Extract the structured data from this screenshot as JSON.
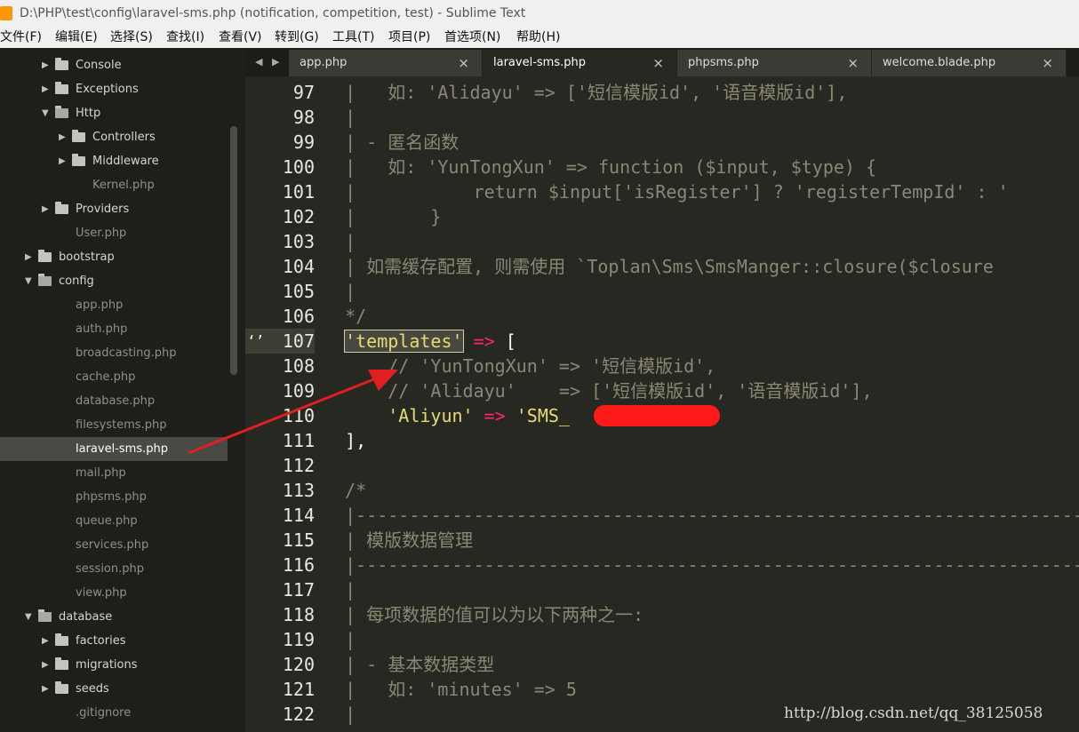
{
  "window": {
    "title": "D:\\PHP\\test\\config\\laravel-sms.php (notification, competition, test) - Sublime Text"
  },
  "menu": [
    "文件(F)",
    "编辑(E)",
    "选择(S)",
    "查找(I)",
    "查看(V)",
    "转到(G)",
    "工具(T)",
    "项目(P)",
    "首选项(N)",
    "帮助(H)"
  ],
  "sidebar": {
    "items": [
      {
        "label": "Console",
        "type": "folder"
      },
      {
        "label": "Exceptions",
        "type": "folder"
      },
      {
        "label": "Http",
        "type": "folder-open"
      },
      {
        "label": "Controllers",
        "type": "folder"
      },
      {
        "label": "Middleware",
        "type": "folder"
      },
      {
        "label": "Kernel.php",
        "type": "file"
      },
      {
        "label": "Providers",
        "type": "folder"
      },
      {
        "label": "User.php",
        "type": "file"
      },
      {
        "label": "bootstrap",
        "type": "folder"
      },
      {
        "label": "config",
        "type": "folder-open"
      },
      {
        "label": "app.php",
        "type": "file"
      },
      {
        "label": "auth.php",
        "type": "file"
      },
      {
        "label": "broadcasting.php",
        "type": "file"
      },
      {
        "label": "cache.php",
        "type": "file"
      },
      {
        "label": "database.php",
        "type": "file"
      },
      {
        "label": "filesystems.php",
        "type": "file"
      },
      {
        "label": "laravel-sms.php",
        "type": "file",
        "selected": true
      },
      {
        "label": "mail.php",
        "type": "file"
      },
      {
        "label": "phpsms.php",
        "type": "file"
      },
      {
        "label": "queue.php",
        "type": "file"
      },
      {
        "label": "services.php",
        "type": "file"
      },
      {
        "label": "session.php",
        "type": "file"
      },
      {
        "label": "view.php",
        "type": "file"
      },
      {
        "label": "database",
        "type": "folder-open"
      },
      {
        "label": "factories",
        "type": "folder"
      },
      {
        "label": "migrations",
        "type": "folder"
      },
      {
        "label": "seeds",
        "type": "folder"
      },
      {
        "label": ".gitignore",
        "type": "file"
      }
    ]
  },
  "tabs": [
    {
      "label": "app.php"
    },
    {
      "label": "laravel-sms.php",
      "active": true
    },
    {
      "label": "phpsms.php"
    },
    {
      "label": "welcome.blade.php"
    }
  ],
  "editor": {
    "current_line": 107,
    "lines": [
      {
        "num": "97",
        "segments": [
          {
            "c": "com",
            "t": "  |   如: 'Alidayu' => ['短信模版id', '语音模版id'],"
          }
        ]
      },
      {
        "num": "98",
        "segments": [
          {
            "c": "com",
            "t": "  |"
          }
        ]
      },
      {
        "num": "99",
        "segments": [
          {
            "c": "com",
            "t": "  | - 匿名函数"
          }
        ]
      },
      {
        "num": "100",
        "segments": [
          {
            "c": "com",
            "t": "  |   如: 'YunTongXun' => function ($input, $type) {"
          }
        ]
      },
      {
        "num": "101",
        "segments": [
          {
            "c": "com",
            "t": "  |           return $input['isRegister'] ? 'registerTempId' : '"
          }
        ]
      },
      {
        "num": "102",
        "segments": [
          {
            "c": "com",
            "t": "  |       }"
          }
        ]
      },
      {
        "num": "103",
        "segments": [
          {
            "c": "com",
            "t": "  |"
          }
        ]
      },
      {
        "num": "104",
        "segments": [
          {
            "c": "com",
            "t": "  | 如需缓存配置, 则需使用 `Toplan\\Sms\\SmsManger::closure($closure"
          }
        ]
      },
      {
        "num": "105",
        "segments": [
          {
            "c": "com",
            "t": "  |"
          }
        ]
      },
      {
        "num": "106",
        "segments": [
          {
            "c": "com",
            "t": "  */"
          }
        ]
      },
      {
        "num": "107",
        "segments": [
          {
            "c": "white",
            "t": "  "
          },
          {
            "c": "str",
            "t": "'templates'",
            "box": true
          },
          {
            "c": "op",
            "t": " =>"
          },
          {
            "c": "white",
            "t": " ["
          }
        ]
      },
      {
        "num": "108",
        "segments": [
          {
            "c": "com",
            "t": "      // 'YunTongXun' => '短信模版id',"
          }
        ]
      },
      {
        "num": "109",
        "segments": [
          {
            "c": "com",
            "t": "      // 'Alidayu'    => ['短信模版id', '语音模版id'],"
          }
        ]
      },
      {
        "num": "110",
        "segments": [
          {
            "c": "white",
            "t": "      "
          },
          {
            "c": "str",
            "t": "'Aliyun'"
          },
          {
            "c": "op",
            "t": " =>"
          },
          {
            "c": "white",
            "t": " "
          },
          {
            "c": "str",
            "t": "'SMS_          '"
          },
          {
            "c": "white",
            "t": ","
          }
        ]
      },
      {
        "num": "111",
        "segments": [
          {
            "c": "white",
            "t": "  ],"
          }
        ]
      },
      {
        "num": "112",
        "segments": [
          {
            "c": "white",
            "t": ""
          }
        ]
      },
      {
        "num": "113",
        "segments": [
          {
            "c": "com",
            "t": "  /*"
          }
        ]
      },
      {
        "num": "114",
        "segments": [
          {
            "c": "com",
            "t": "  |--------------------------------------------------------------------------"
          }
        ]
      },
      {
        "num": "115",
        "segments": [
          {
            "c": "com",
            "t": "  | 模版数据管理"
          }
        ]
      },
      {
        "num": "116",
        "segments": [
          {
            "c": "com",
            "t": "  |--------------------------------------------------------------------------"
          }
        ]
      },
      {
        "num": "117",
        "segments": [
          {
            "c": "com",
            "t": "  |"
          }
        ]
      },
      {
        "num": "118",
        "segments": [
          {
            "c": "com",
            "t": "  | 每项数据的值可以为以下两种之一:"
          }
        ]
      },
      {
        "num": "119",
        "segments": [
          {
            "c": "com",
            "t": "  |"
          }
        ]
      },
      {
        "num": "120",
        "segments": [
          {
            "c": "com",
            "t": "  | - 基本数据类型"
          }
        ]
      },
      {
        "num": "121",
        "segments": [
          {
            "c": "com",
            "t": "  |   如: 'minutes' => 5"
          }
        ]
      },
      {
        "num": "122",
        "segments": [
          {
            "c": "com",
            "t": "  |"
          }
        ]
      }
    ]
  },
  "watermark": "http://blog.csdn.net/qq_38125058",
  "colors": {
    "background": "#272822",
    "sidebar": "#1e1f1b",
    "annotation": "#e02020",
    "redaction": "#ff1a1a"
  }
}
